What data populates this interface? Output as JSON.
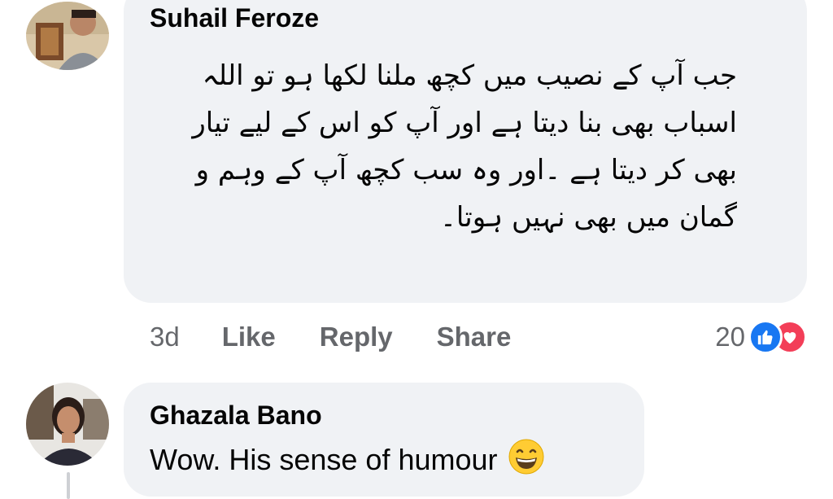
{
  "comments": [
    {
      "author": "Suhail Feroze",
      "body_lines": [
        "جب آپ کے نصیب میں کچھ ملنا لکھا ہو تو اللہ",
        "اسباب بھی بنا دیتا ہے اور آپ کو اس کے لیے تیار",
        "بھی کر دیتا ہے ۔اور وہ سب کچھ آپ کے وہم و",
        "گمان میں بھی نہیں ہوتا۔"
      ],
      "time": "3d",
      "actions": {
        "like": "Like",
        "reply": "Reply",
        "share": "Share"
      },
      "reaction_count": "20",
      "reaction_icons": [
        "like-icon",
        "love-icon"
      ]
    },
    {
      "author": "Ghazala Bano",
      "body": "Wow. His sense of humour",
      "emoji": "grinning-face-smiling-eyes-icon"
    }
  ],
  "colors": {
    "bubble": "#f0f2f5",
    "meta_text": "#65676b",
    "like_blue": "#1877f2",
    "love_red": "#f33e58"
  }
}
